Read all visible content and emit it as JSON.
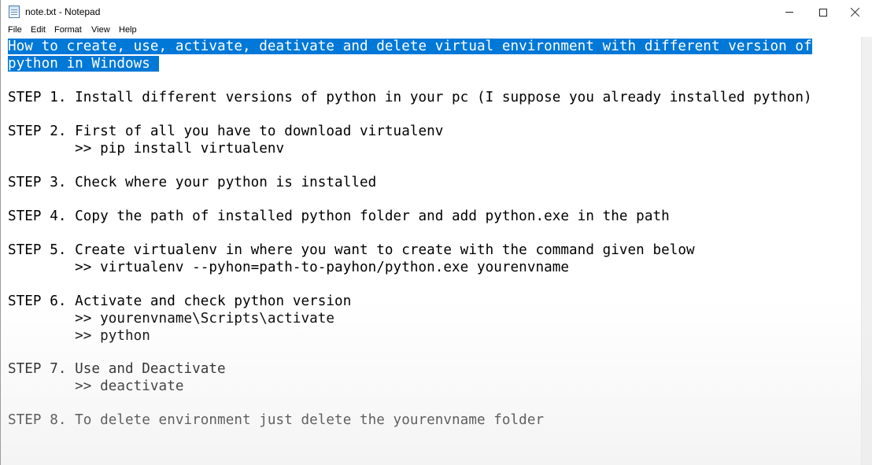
{
  "window": {
    "title": "note.txt - Notepad",
    "icon": "notepad-icon",
    "controls": {
      "minimize": "minimize-icon",
      "maximize": "maximize-icon",
      "close": "close-icon"
    }
  },
  "menu": [
    "File",
    "Edit",
    "Format",
    "View",
    "Help"
  ],
  "selection_color": "#0078d7",
  "document": {
    "heading_line1": "How to create, use, activate, deativate and delete virtual environment with different version of",
    "heading_line2": "python in Windows",
    "step1": "STEP 1. Install different versions of python in your pc (I suppose you already installed python)",
    "step2": "STEP 2. First of all you have to download virtualenv",
    "step2_cmd": "        >> pip install virtualenv",
    "step3": "STEP 3. Check where your python is installed",
    "step4": "STEP 4. Copy the path of installed python folder and add python.exe in the path",
    "step5": "STEP 5. Create virtualenv in where you want to create with the command given below",
    "step5_cmd": "        >> virtualenv --pyhon=path-to-payhon/python.exe yourenvname",
    "step6": "STEP 6. Activate and check python version",
    "step6_cmd1": "        >> yourenvname\\Scripts\\activate",
    "step6_cmd2": "        >> python",
    "step7": "STEP 7. Use and Deactivate",
    "step7_cmd": "        >> deactivate",
    "step8": "STEP 8. To delete environment just delete the yourenvname folder"
  }
}
